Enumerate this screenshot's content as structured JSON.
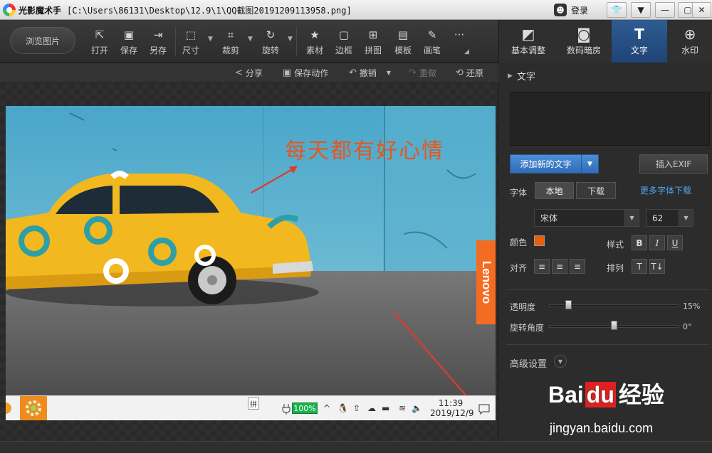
{
  "window": {
    "app_name": "光影魔术手",
    "file_path": "[C:\\Users\\86131\\Desktop\\12.9\\1\\QQ截图20191209113958.png]",
    "login_label": "登录"
  },
  "toolbar": {
    "browse_label": "浏览图片",
    "tools": [
      {
        "label": "打开",
        "icon": "open-icon"
      },
      {
        "label": "保存",
        "icon": "save-icon"
      },
      {
        "label": "另存",
        "icon": "save-as-icon"
      },
      {
        "label": "尺寸",
        "icon": "resize-icon"
      },
      {
        "label": "裁剪",
        "icon": "crop-icon"
      },
      {
        "label": "旋转",
        "icon": "rotate-icon"
      },
      {
        "label": "素材",
        "icon": "material-icon"
      },
      {
        "label": "边框",
        "icon": "border-icon"
      },
      {
        "label": "拼图",
        "icon": "collage-icon"
      },
      {
        "label": "模板",
        "icon": "template-icon"
      },
      {
        "label": "画笔",
        "icon": "brush-icon"
      },
      {
        "label": "···",
        "icon": "more-icon"
      }
    ]
  },
  "right_tabs": [
    {
      "label": "基本调整",
      "icon": "basic-adjust-icon"
    },
    {
      "label": "数码暗房",
      "icon": "darkroom-icon"
    },
    {
      "label": "文字",
      "icon": "text-icon",
      "active": true
    },
    {
      "label": "水印",
      "icon": "watermark-icon"
    }
  ],
  "actions": {
    "share": "分享",
    "save_action": "保存动作",
    "undo": "撤销",
    "redo": "重做",
    "restore": "还原"
  },
  "image": {
    "overlay_text": "每天都有好心情",
    "brand_tag": "Lenovo",
    "taskbar": {
      "ime": "拼",
      "battery": "100%",
      "time": "11:39",
      "date": "2019/12/9"
    }
  },
  "text_panel": {
    "title": "文字",
    "add_text_label": "添加新的文字",
    "insert_exif_label": "插入EXIF",
    "font_label": "字体",
    "font_local": "本地",
    "font_download": "下载",
    "more_fonts_link": "更多字体下载",
    "font_family": "宋体",
    "font_size": "62",
    "color_label": "颜色",
    "color_value": "#e85f0c",
    "style_label": "样式",
    "style_bold": "B",
    "style_italic": "I",
    "style_underline": "U",
    "align_label": "对齐",
    "arrange_label": "排列",
    "opacity_label": "透明度",
    "opacity_value": "15%",
    "opacity_fraction": 0.15,
    "rotation_label": "旋转角度",
    "rotation_value": "0°",
    "rotation_fraction": 0.5,
    "advanced_label": "高级设置"
  },
  "watermark": {
    "brand_left": "Bai",
    "brand_mid": "du",
    "brand_right": "经验",
    "url": "jingyan.baidu.com"
  },
  "colors": {
    "accent_blue": "#2f6db7",
    "overlay_text_color": "#e5571f",
    "lenovo_orange": "#f36c21"
  }
}
